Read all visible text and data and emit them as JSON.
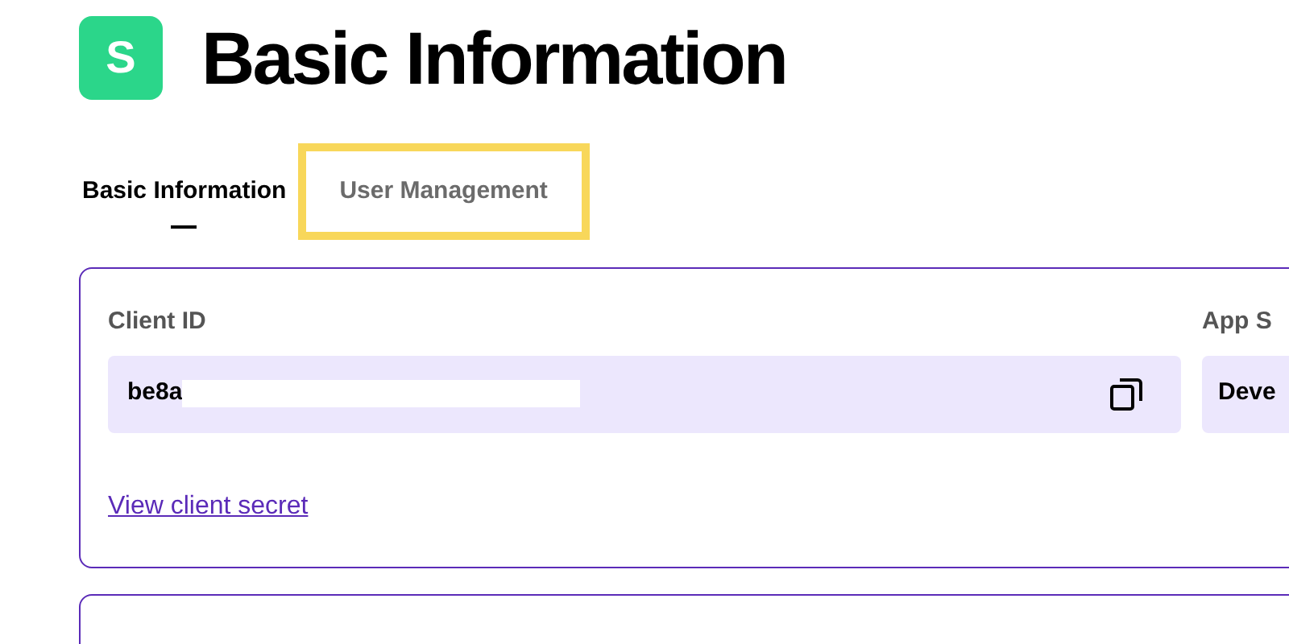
{
  "app_icon": {
    "letter": "S"
  },
  "title": "Basic Information",
  "tabs": [
    {
      "label": "Basic Information",
      "selected": true,
      "highlighted": false
    },
    {
      "label": "User Management",
      "selected": false,
      "highlighted": true
    }
  ],
  "credentials_card": {
    "client_id": {
      "label": "Client ID",
      "value": "be8a",
      "redacted": true
    },
    "app_status": {
      "label": "App S",
      "value": "Deve"
    },
    "secret_link": "View client secret"
  }
}
